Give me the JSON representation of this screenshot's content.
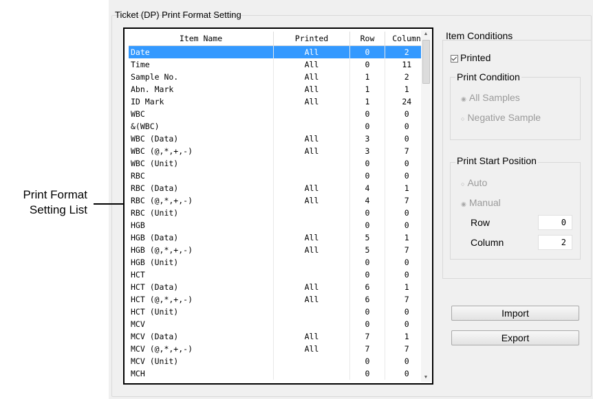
{
  "annotation": {
    "label_line1": "Print Format",
    "label_line2": "Setting List"
  },
  "group_title": "Ticket (DP) Print Format Setting",
  "table": {
    "headers": {
      "name": "Item Name",
      "printed": "Printed",
      "row": "Row",
      "column": "Column"
    },
    "rows": [
      {
        "name": "Date",
        "printed": "All",
        "row": "0",
        "column": "2",
        "selected": true
      },
      {
        "name": "Time",
        "printed": "All",
        "row": "0",
        "column": "11"
      },
      {
        "name": "Sample No.",
        "printed": "All",
        "row": "1",
        "column": "2"
      },
      {
        "name": "Abn. Mark",
        "printed": "All",
        "row": "1",
        "column": "1"
      },
      {
        "name": "ID Mark",
        "printed": "All",
        "row": "1",
        "column": "24"
      },
      {
        "name": "WBC",
        "printed": "",
        "row": "0",
        "column": "0"
      },
      {
        "name": "&(WBC)",
        "printed": "",
        "row": "0",
        "column": "0"
      },
      {
        "name": "WBC (Data)",
        "printed": "All",
        "row": "3",
        "column": "0"
      },
      {
        "name": "WBC (@,*,+,-)",
        "printed": "All",
        "row": "3",
        "column": "7"
      },
      {
        "name": "WBC (Unit)",
        "printed": "",
        "row": "0",
        "column": "0"
      },
      {
        "name": "RBC",
        "printed": "",
        "row": "0",
        "column": "0"
      },
      {
        "name": "RBC (Data)",
        "printed": "All",
        "row": "4",
        "column": "1"
      },
      {
        "name": "RBC (@,*,+,-)",
        "printed": "All",
        "row": "4",
        "column": "7"
      },
      {
        "name": "RBC (Unit)",
        "printed": "",
        "row": "0",
        "column": "0"
      },
      {
        "name": "HGB",
        "printed": "",
        "row": "0",
        "column": "0"
      },
      {
        "name": "HGB (Data)",
        "printed": "All",
        "row": "5",
        "column": "1"
      },
      {
        "name": "HGB (@,*,+,-)",
        "printed": "All",
        "row": "5",
        "column": "7"
      },
      {
        "name": "HGB (Unit)",
        "printed": "",
        "row": "0",
        "column": "0"
      },
      {
        "name": "HCT",
        "printed": "",
        "row": "0",
        "column": "0"
      },
      {
        "name": "HCT (Data)",
        "printed": "All",
        "row": "6",
        "column": "1"
      },
      {
        "name": "HCT (@,*,+,-)",
        "printed": "All",
        "row": "6",
        "column": "7"
      },
      {
        "name": "HCT (Unit)",
        "printed": "",
        "row": "0",
        "column": "0"
      },
      {
        "name": "MCV",
        "printed": "",
        "row": "0",
        "column": "0"
      },
      {
        "name": "MCV (Data)",
        "printed": "All",
        "row": "7",
        "column": "1"
      },
      {
        "name": "MCV (@,*,+,-)",
        "printed": "All",
        "row": "7",
        "column": "7"
      },
      {
        "name": "MCV (Unit)",
        "printed": "",
        "row": "0",
        "column": "0"
      },
      {
        "name": "MCH",
        "printed": "",
        "row": "0",
        "column": "0"
      }
    ]
  },
  "item_conditions": {
    "title": "Item Conditions",
    "printed_checkbox": {
      "label": "Printed",
      "checked": true
    },
    "print_condition": {
      "title": "Print Condition",
      "options": [
        {
          "label": "All Samples",
          "selected": true
        },
        {
          "label": "Negative Sample",
          "selected": false
        }
      ]
    },
    "print_start_position": {
      "title": "Print Start Position",
      "options": [
        {
          "label": "Auto",
          "selected": false
        },
        {
          "label": "Manual",
          "selected": true
        }
      ],
      "row_label": "Row",
      "row_value": "0",
      "column_label": "Column",
      "column_value": "2"
    }
  },
  "buttons": {
    "import": "Import",
    "export": "Export"
  },
  "colors": {
    "selection": "#3399ff",
    "panel_bg": "#f0f0f0",
    "disabled_text": "#9a9a9a"
  }
}
